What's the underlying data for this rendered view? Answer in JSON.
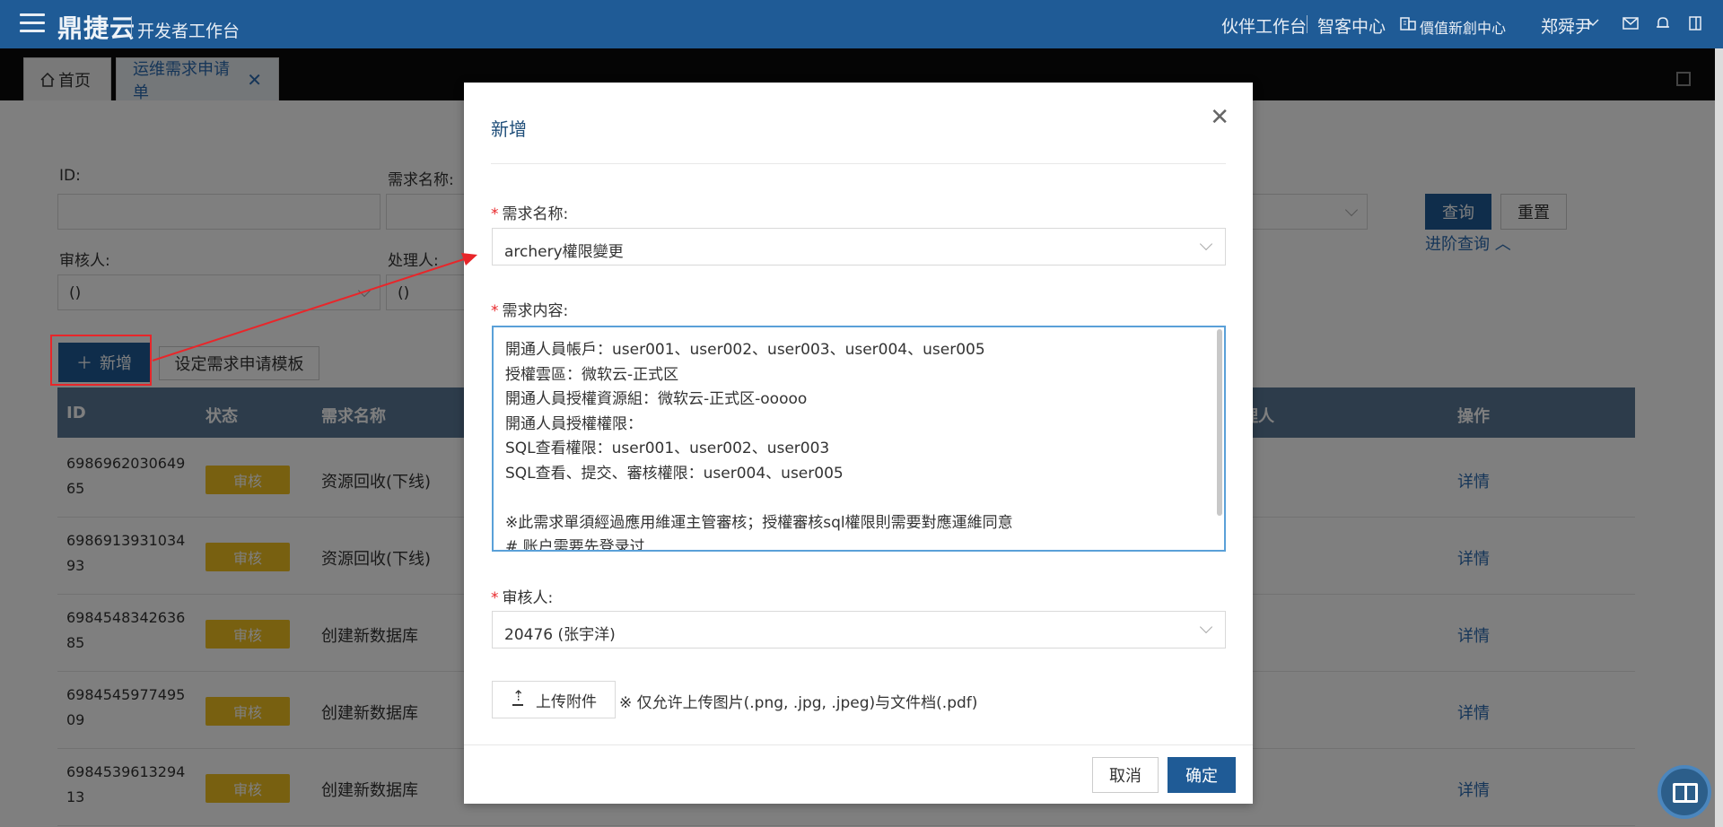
{
  "topbar": {
    "brand": "鼎捷云",
    "subtitle": "开发者工作台",
    "partner": "伙伴工作台",
    "smart": "智客中心",
    "value": "價值新創中心",
    "user": "郑舜尹",
    "icons": [
      "menu-icon",
      "building-icon",
      "chevron-down-icon",
      "mail-icon",
      "bell-icon",
      "doc-icon"
    ]
  },
  "tabs": {
    "home": "首页",
    "current": "运维需求申请单"
  },
  "filters": {
    "id_label": "ID:",
    "name_label": "需求名称:",
    "reviewer_label": "审核人:",
    "handler_label": "处理人:",
    "reviewer_value": "()",
    "handler_value": "()",
    "query": "查询",
    "reset": "重置",
    "advanced": "进阶查询"
  },
  "actions": {
    "new": "新增",
    "template": "设定需求申请模板"
  },
  "table": {
    "headers": [
      "ID",
      "状态",
      "需求名称",
      "理人",
      "操作"
    ],
    "rows": [
      {
        "id": "698696203064965",
        "status": "审核",
        "name": "资源回收(下线)",
        "op": "详情"
      },
      {
        "id": "698691393103493",
        "status": "审核",
        "name": "资源回收(下线)",
        "op": "详情"
      },
      {
        "id": "698454834263685",
        "status": "审核",
        "name": "创建新数据库",
        "op": "详情"
      },
      {
        "id": "698454597749509",
        "status": "审核",
        "name": "创建新数据库",
        "op": "详情"
      },
      {
        "id": "698453961329413",
        "status": "审核",
        "name": "创建新数据库",
        "op": "详情"
      }
    ]
  },
  "modal": {
    "title": "新增",
    "name_label": "需求名称:",
    "name_value": "archery權限變更",
    "content_label": "需求内容:",
    "content_lines": [
      "開通人員帳戶：user001、user002、user003、user004、user005",
      "授權雲區：微软云-正式区",
      "開通人員授權資源組：微软云-正式区-ooooo",
      "開通人員授權權限：",
      "SQL查看權限：user001、user002、user003",
      "SQL查看、提交、審核權限：user004、user005",
      "",
      "※此需求單須經過應用維運主管審核；授權審核sql權限則需要對應運維同意",
      "# 账户需要先登录过"
    ],
    "reviewer_label": "审核人:",
    "reviewer_value": "20476 (张宇洋)",
    "upload": "上传附件",
    "upload_note": "※ 仅允许上传图片(.png, .jpg, .jpeg)与文件档(.pdf)",
    "cancel": "取消",
    "ok": "确定"
  },
  "colors": {
    "primary": "#1f5b96",
    "highlight": "#e8262a",
    "badge": "#f0c020"
  }
}
